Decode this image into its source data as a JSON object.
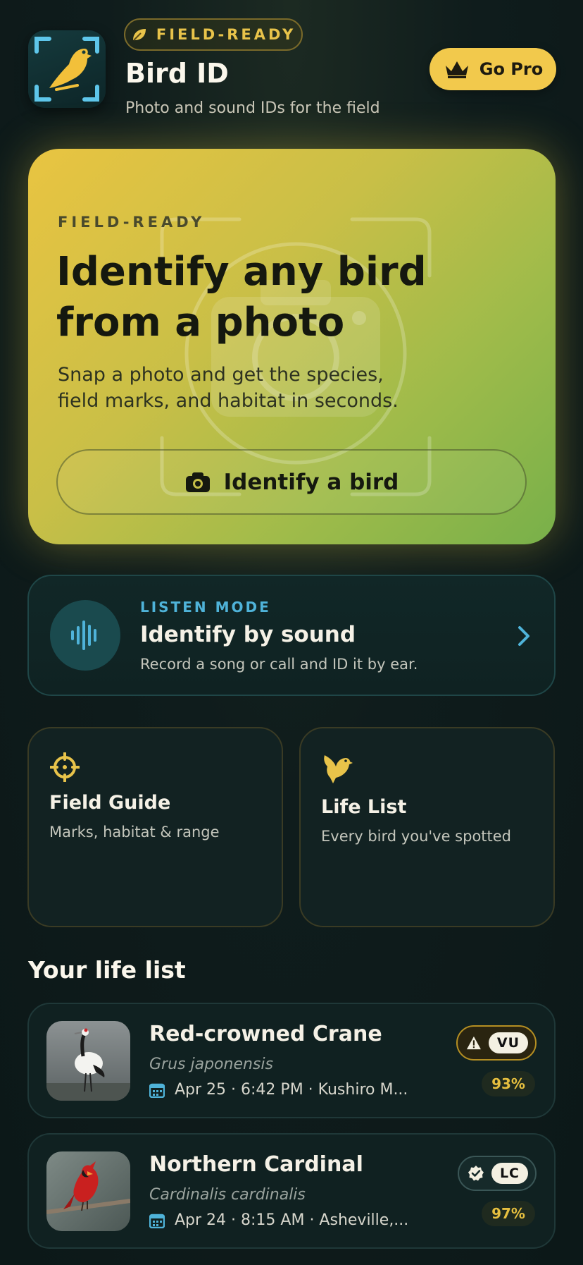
{
  "header": {
    "badge": "FIELD-READY",
    "title": "Bird ID",
    "subtitle": "Photo and sound IDs for the field",
    "pro_label": "Go Pro"
  },
  "hero": {
    "eyebrow": "FIELD-READY",
    "title": "Identify any bird from a photo",
    "description": "Snap a photo and get the species, field marks, and habitat in seconds.",
    "button_label": "Identify a bird"
  },
  "listen": {
    "eyebrow": "LISTEN MODE",
    "title": "Identify by sound",
    "subtitle": "Record a song or call and ID it by ear."
  },
  "cards": [
    {
      "title": "Field Guide",
      "subtitle": "Marks, habitat & range",
      "icon": "crosshair-icon"
    },
    {
      "title": "Life List",
      "subtitle": "Every bird you've spotted",
      "icon": "bird-icon"
    }
  ],
  "life_list": {
    "title": "Your life list",
    "items": [
      {
        "name": "Red-crowned Crane",
        "scientific": "Grus japonensis",
        "meta": "Apr 25 · 6:42 PM · Kushiro M...",
        "status": "VU",
        "status_icon": "warning-icon",
        "confidence": "93%"
      },
      {
        "name": "Northern Cardinal",
        "scientific": "Cardinalis cardinalis",
        "meta": "Apr 24 · 8:15 AM · Asheville,...",
        "status": "LC",
        "status_icon": "verified-icon",
        "confidence": "97%"
      }
    ]
  },
  "colors": {
    "accent": "#f2c94c",
    "teal": "#4fb3d9",
    "background": "#0f1c1c"
  }
}
